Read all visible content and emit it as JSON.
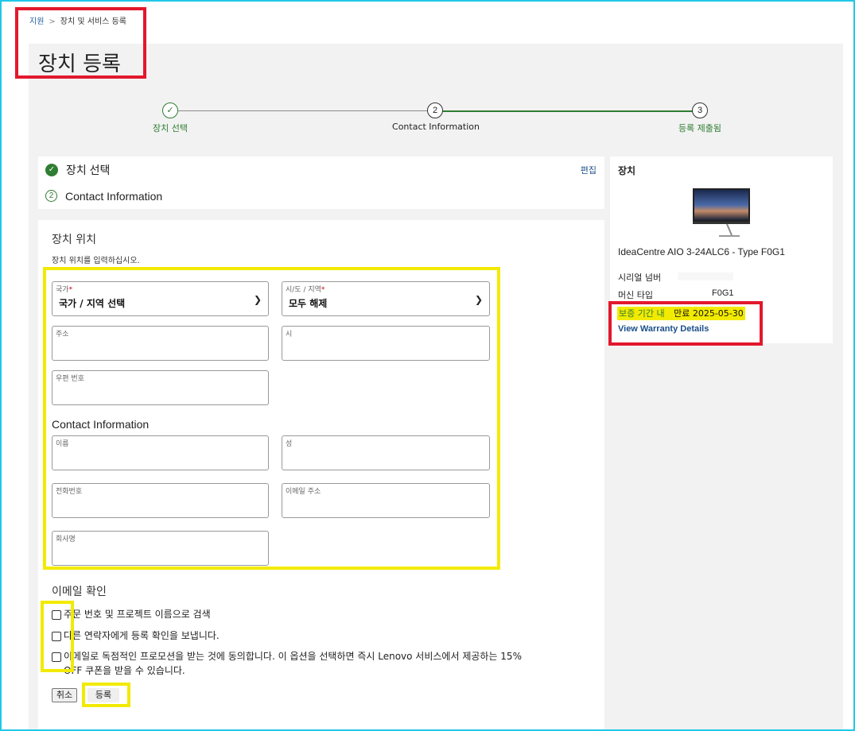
{
  "breadcrumb": {
    "home": "지원",
    "separator": ">",
    "current": "장치 및 서비스 등록"
  },
  "page_title": "장치 등록",
  "stepper": {
    "steps": [
      {
        "number": "✓",
        "label": "장치 선택",
        "state": "done"
      },
      {
        "number": "2",
        "label": "Contact Information",
        "state": "active"
      },
      {
        "number": "3",
        "label": "등록 제출됨",
        "state": "pending"
      }
    ],
    "done_color": "#2f7d32"
  },
  "sections": {
    "device_select": {
      "title": "장치 선택",
      "edit": "편집"
    },
    "contact": {
      "number": "2",
      "title": "Contact Information"
    }
  },
  "location": {
    "heading": "장치 위치",
    "instruction": "장치 위치를 입력하십시오.",
    "country": {
      "label": "국가",
      "required": "*",
      "value": "국가 / 지역 선택"
    },
    "state": {
      "label": "시/도 / 지역",
      "required": "*",
      "value": "모두 해제"
    },
    "address": {
      "label": "주소"
    },
    "city": {
      "label": "시"
    },
    "postal": {
      "label": "우편 번호"
    }
  },
  "contact_info": {
    "heading": "Contact Information",
    "first_name": {
      "label": "이름"
    },
    "last_name": {
      "label": "성"
    },
    "phone": {
      "label": "전화번호"
    },
    "email": {
      "label": "이메일 주소"
    },
    "company": {
      "label": "회사명"
    }
  },
  "email_confirm": {
    "heading": "이메일 확인",
    "options": [
      "주문 번호 및 프로젝트 이름으로 검색",
      "다른 연락자에게 등록 확인을 보냅니다.",
      "이메일로 독점적인 프로모션을 받는 것에 동의합니다. 이 옵션을 선택하면 즉시 Lenovo 서비스에서 제공하는 15%",
      "OFF 쿠폰을 받을 수 있습니다."
    ]
  },
  "buttons": {
    "cancel": "취소",
    "submit": "등록"
  },
  "device": {
    "heading": "장치",
    "product_name": "IdeaCentre AIO 3-24ALC6 - Type F0G1",
    "serial_label": "시리얼 넘버",
    "machine_type_label": "머신 타입",
    "machine_type_value": "F0G1",
    "warranty_status": "보증 기간 내",
    "warranty_expiry": "만료 2025-05-30",
    "warranty_link": "View Warranty Details"
  },
  "colors": {
    "accent_green": "#2f7d32",
    "link_blue": "#1a4f8a",
    "highlight_yellow": "#f2ea00",
    "annotation_red": "#e2182d"
  }
}
